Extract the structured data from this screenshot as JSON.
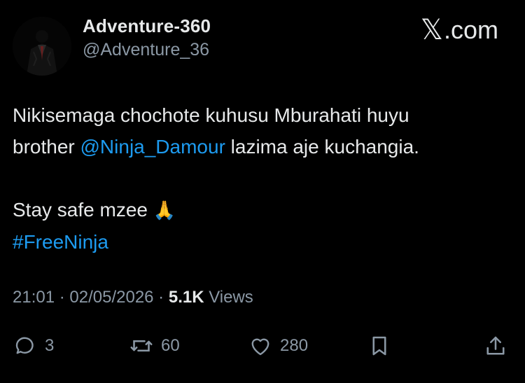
{
  "author": {
    "display_name": "Adventure-360",
    "handle": "@Adventure_36",
    "avatar_icon": "suited-figure-avatar"
  },
  "brand": {
    "logo_text": ".com",
    "logo_glyph": "𝕏"
  },
  "tweet": {
    "line1_text": "Nikisemaga chochote kuhusu Mburahati huyu",
    "line2_prefix": "brother ",
    "mention": "@Ninja_Damour",
    "line2_suffix": " lazima aje kuchangia.",
    "line3_text": "Stay safe mzee ",
    "emoji": "🙏",
    "hashtag": "#FreeNinja"
  },
  "meta": {
    "time": "21:01",
    "sep1": " · ",
    "date": "02/05/2026",
    "sep2": " · ",
    "views_count": "5.1K",
    "views_label": " Views"
  },
  "actions": {
    "replies": "3",
    "retweets": "60",
    "likes": "280"
  },
  "colors": {
    "background": "#000000",
    "text": "#e7e9ea",
    "secondary": "#8b98a5",
    "link": "#1d9bf0"
  }
}
